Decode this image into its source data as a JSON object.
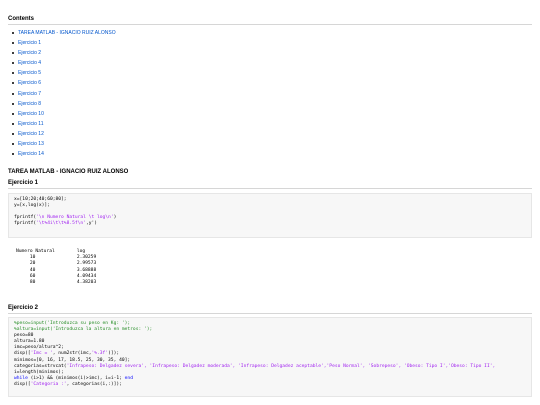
{
  "contents": {
    "heading": "Contents",
    "items": [
      "TAREA MATLAB - IGNACIO RUIZ ALONSO",
      "Ejercicio 1",
      "Ejercicio 2",
      "Ejercicio 4",
      "Ejercicio 5",
      "Ejercicio 6",
      "Ejercicio 7",
      "Ejercicio 8",
      "Ejercicio 10",
      "Ejercicio 11",
      "Ejercicio 12",
      "Ejercicio 13",
      "Ejercicio 14"
    ]
  },
  "title": "TAREA MATLAB - IGNACIO RUIZ ALONSO",
  "ejercicio1": {
    "heading": "Ejercicio 1",
    "code": {
      "l1": "x=[10;20;40;60;80];",
      "l2": "y=[x,log(x)];",
      "l3": "",
      "l4_pre": "fprintf(",
      "l4_str": "'\\n Numero Natural \\t log\\n'",
      "l4_post": ")",
      "l5_pre": "fprintf(",
      "l5_str": "'\\t%4i\\t\\t%8.5f\\n'",
      "l5_post": ",y')"
    },
    "output": {
      "header": "Numero Natural        log",
      "rows": [
        "     10               2.30259",
        "     20               2.99573",
        "     40               3.68888",
        "     60               4.09434",
        "     80               4.38203"
      ]
    }
  },
  "ejercicio2": {
    "heading": "Ejercicio 2",
    "code": {
      "c1": "%peso=input('Introduzca su peso en Kg: ');",
      "c2": "%altura=input('Introduzca la altura en metros: ');",
      "l3": "peso=80",
      "l4": "altura=1.80",
      "l5": "imc=peso/altura^2;",
      "l6_pre": "disp([",
      "l6_str": "'Imc = '",
      "l6_mid": ", num2str(imc,",
      "l6_str2": "'%.3f'",
      "l6_post": ")]);",
      "l7": "minimos=[0, 16, 17, 18.5, 25, 30, 35, 40];",
      "l8_pre": "categorias=strvcat(",
      "l8_str": "'Infrapeso: Delgadez severa', 'Infrapeso: Delgadez moderada', 'Infrapeso: Delgadez aceptable','Peso Normal', 'Sobrepeso', 'Obeso: Tipo I','Obeso: Tipo II',",
      "l9": "i=length(minimos);",
      "l10_kw1": "while",
      "l10_mid": " (i>1) && (minimos(i)>imc), i=i-1; ",
      "l10_kw2": "end",
      "l11_pre": "disp([",
      "l11_str": "'Categoria :'",
      "l11_post": ", categorias(i,:)]);"
    }
  }
}
